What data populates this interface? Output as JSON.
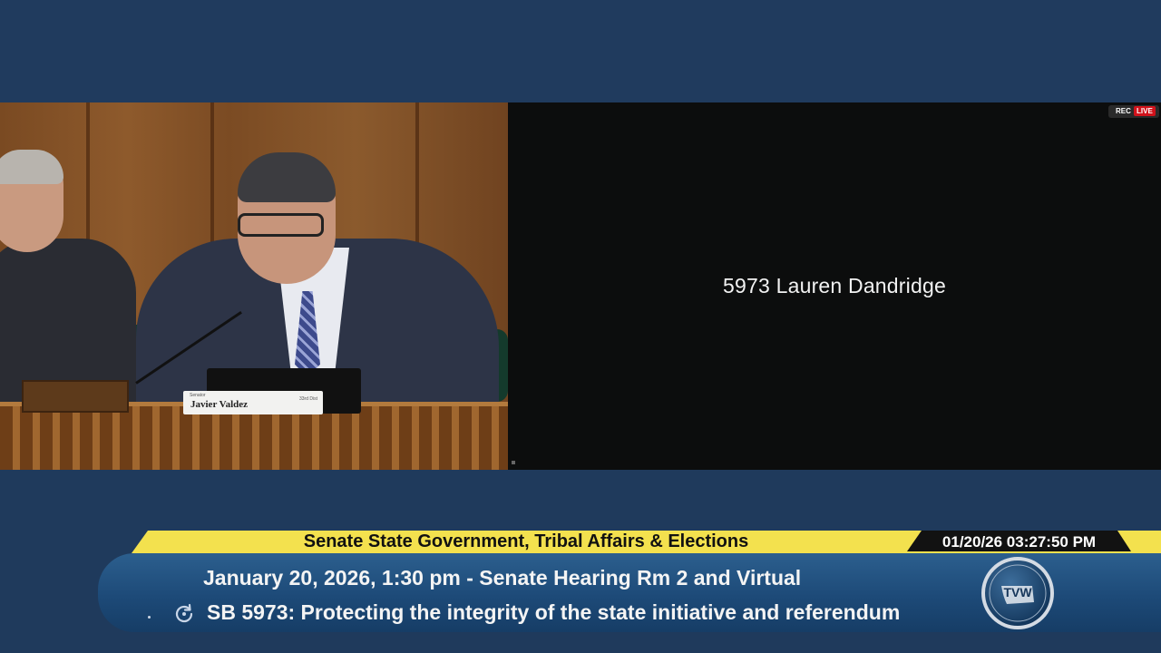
{
  "camera": {
    "nameplate": {
      "title": "Senator",
      "name": "Javier Valdez",
      "district": "33rd Dist"
    }
  },
  "slate": {
    "text": "5973 Lauren Dandridge"
  },
  "status": {
    "rec": "REC",
    "live": "LIVE"
  },
  "lower_third": {
    "committee": "Senate State Government, Tribal Affairs & Elections",
    "timestamp": "01/20/26 03:27:50 PM",
    "session_line": "January 20, 2026, 1:30 pm - Senate Hearing Rm 2 and Virtual",
    "bill_line": "SB 5973: Protecting the integrity of the state initiative and referendum"
  },
  "branding": {
    "logo_text": "TVW",
    "logo_name": "tvw-logo"
  },
  "colors": {
    "background": "#1f3a5c",
    "yellow_bar": "#f3e14e",
    "live_red": "#d0121b"
  }
}
